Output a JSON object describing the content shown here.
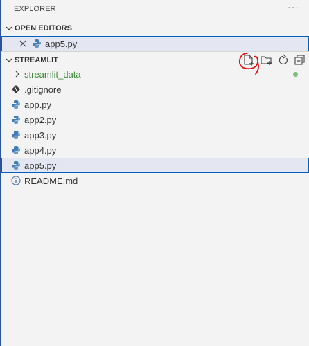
{
  "explorer": {
    "title": "EXPLORER",
    "more_label": "···"
  },
  "open_editors": {
    "header": "OPEN EDITORS",
    "items": [
      {
        "label": "app5.py",
        "icon": "python-file-icon"
      }
    ]
  },
  "workspace": {
    "header": "STREAMLIT",
    "actions": [
      {
        "name": "new-file-button",
        "icon": "new-file-icon"
      },
      {
        "name": "new-folder-button",
        "icon": "new-folder-icon"
      },
      {
        "name": "refresh-button",
        "icon": "refresh-icon"
      },
      {
        "name": "collapse-all-button",
        "icon": "collapse-all-icon"
      }
    ],
    "items": [
      {
        "label": "streamlit_data",
        "type": "folder",
        "icon": "chevron-right-icon"
      },
      {
        "label": ".gitignore",
        "type": "file",
        "icon": "git-icon"
      },
      {
        "label": "app.py",
        "type": "file",
        "icon": "python-file-icon"
      },
      {
        "label": "app2.py",
        "type": "file",
        "icon": "python-file-icon"
      },
      {
        "label": "app3.py",
        "type": "file",
        "icon": "python-file-icon"
      },
      {
        "label": "app4.py",
        "type": "file",
        "icon": "python-file-icon"
      },
      {
        "label": "app5.py",
        "type": "file",
        "icon": "python-file-icon",
        "selected": true
      },
      {
        "label": "README.md",
        "type": "file",
        "icon": "info-icon"
      }
    ]
  },
  "colors": {
    "accent": "#0060c0",
    "selection_bg": "#e4e6f1",
    "folder_text": "#388a34",
    "modified_dot": "#7bbf7b",
    "annotation": "#e01010",
    "python_blue": "#3f7cb8"
  }
}
